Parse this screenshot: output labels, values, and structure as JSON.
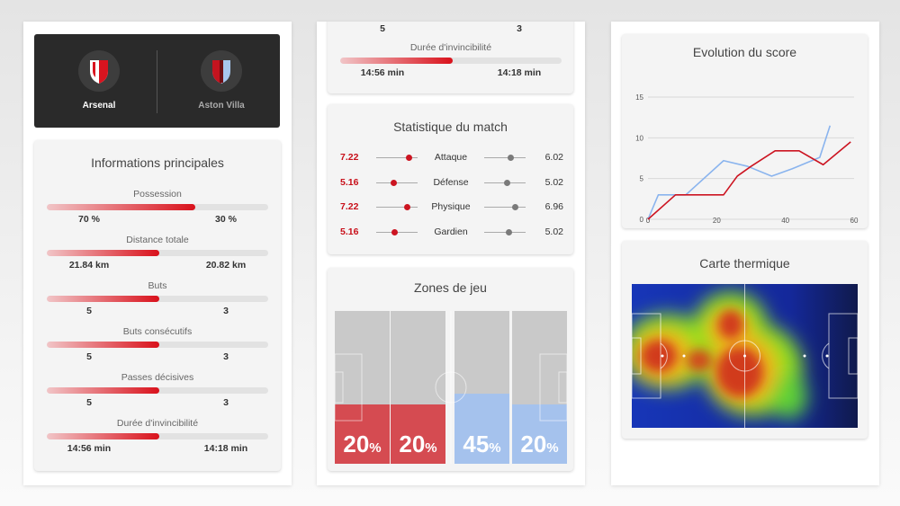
{
  "match": {
    "home": {
      "name": "Arsenal"
    },
    "away": {
      "name": "Aston Villa"
    }
  },
  "main_info": {
    "title": "Informations principales",
    "stats": [
      {
        "label": "Possession",
        "home": "70 %",
        "away": "30 %",
        "ratio": 0.67
      },
      {
        "label": "Distance totale",
        "home": "21.84 km",
        "away": "20.82 km",
        "ratio": 0.51
      },
      {
        "label": "Buts",
        "home": "5",
        "away": "3",
        "ratio": 0.51
      },
      {
        "label": "Buts consécutifs",
        "home": "5",
        "away": "3",
        "ratio": 0.51
      },
      {
        "label": "Passes décisives",
        "home": "5",
        "away": "3",
        "ratio": 0.51
      },
      {
        "label": "Durée d'invincibilité",
        "home": "14:56 min",
        "away": "14:18 min",
        "ratio": 0.51
      }
    ]
  },
  "top_partial": {
    "prev_home": "5",
    "prev_away": "3",
    "label": "Durée d'invincibilité",
    "home": "14:56 min",
    "away": "14:18 min",
    "ratio": 0.51
  },
  "match_stats": {
    "title": "Statistique du match",
    "rows": [
      {
        "label": "Attaque",
        "home": "7.22",
        "away": "6.02",
        "home_level": 0.8,
        "away_level": 0.65
      },
      {
        "label": "Défense",
        "home": "5.16",
        "away": "5.02",
        "home_level": 0.42,
        "away_level": 0.55
      },
      {
        "label": "Physique",
        "home": "7.22",
        "away": "6.96",
        "home_level": 0.75,
        "away_level": 0.75
      },
      {
        "label": "Gardien",
        "home": "5.16",
        "away": "5.02",
        "home_level": 0.45,
        "away_level": 0.6
      }
    ]
  },
  "zones": {
    "title": "Zones de jeu",
    "items": [
      {
        "value": "20",
        "unit": "%",
        "pct": 0.39,
        "color": "#d6444b"
      },
      {
        "value": "20",
        "unit": "%",
        "pct": 0.39,
        "color": "#d6444b"
      },
      {
        "value": "45",
        "unit": "%",
        "pct": 0.46,
        "color": "#a3c2ef"
      },
      {
        "value": "20",
        "unit": "%",
        "pct": 0.39,
        "color": "#a3c2ef"
      }
    ]
  },
  "score_evolution": {
    "title": "Evolution du score"
  },
  "chart_data": {
    "type": "line",
    "title": "Evolution du score",
    "xlim": [
      0,
      60
    ],
    "ylim": [
      0,
      15
    ],
    "xticks": [
      "0",
      "20",
      "40",
      "60"
    ],
    "yticks": [
      "0",
      "5",
      "10",
      "15"
    ],
    "grid": true,
    "series": [
      {
        "color": "#cc1421",
        "x": [
          0,
          8,
          16,
          22,
          26,
          30,
          37,
          44,
          51,
          59
        ],
        "y": [
          0,
          3,
          3,
          3,
          5.3,
          6.5,
          8.4,
          8.4,
          6.7,
          9.5
        ]
      },
      {
        "color": "#8ab4ee",
        "x": [
          0,
          3,
          11,
          22,
          29,
          36,
          42,
          50,
          53
        ],
        "y": [
          0,
          3,
          3,
          7.2,
          6.5,
          5.3,
          6.2,
          7.6,
          11.5
        ]
      }
    ]
  },
  "heatmap": {
    "title": "Carte thermique"
  }
}
